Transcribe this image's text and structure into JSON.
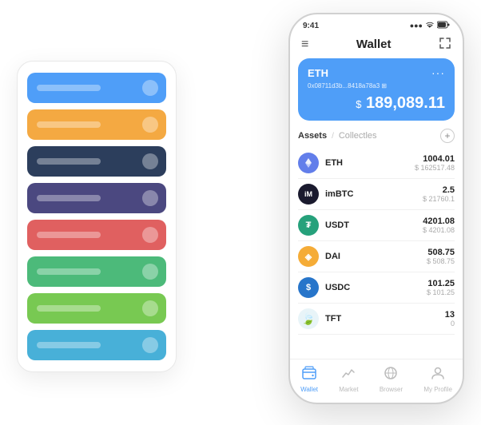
{
  "scene": {
    "leftPanel": {
      "cards": [
        {
          "color": "card-blue",
          "id": "card-1"
        },
        {
          "color": "card-orange",
          "id": "card-2"
        },
        {
          "color": "card-dark",
          "id": "card-3"
        },
        {
          "color": "card-purple",
          "id": "card-4"
        },
        {
          "color": "card-red",
          "id": "card-5"
        },
        {
          "color": "card-green",
          "id": "card-6"
        },
        {
          "color": "card-light-green",
          "id": "card-7"
        },
        {
          "color": "card-teal",
          "id": "card-8"
        }
      ]
    },
    "phone": {
      "statusBar": {
        "time": "9:41",
        "signal": "●●●",
        "wifi": "▲",
        "battery": "▮▮▮"
      },
      "header": {
        "menuIcon": "≡",
        "title": "Wallet",
        "expandIcon": "⤢"
      },
      "ethCard": {
        "symbol": "ETH",
        "dots": "···",
        "address": "0x08711d3b...8418a78a3 ⊞",
        "dollarSign": "$",
        "balance": "189,089.11"
      },
      "assetsSection": {
        "tabActive": "Assets",
        "separator": "/",
        "tabInactive": "Collectles",
        "addIcon": "+"
      },
      "assets": [
        {
          "name": "ETH",
          "icon": "♦",
          "iconClass": "icon-eth",
          "balance": "1004.01",
          "usd": "$ 162517.48"
        },
        {
          "name": "imBTC",
          "icon": "₿",
          "iconClass": "icon-imbtc",
          "balance": "2.5",
          "usd": "$ 21760.1"
        },
        {
          "name": "USDT",
          "icon": "₮",
          "iconClass": "icon-usdt",
          "balance": "4201.08",
          "usd": "$ 4201.08"
        },
        {
          "name": "DAI",
          "icon": "◈",
          "iconClass": "icon-dai",
          "balance": "508.75",
          "usd": "$ 508.75"
        },
        {
          "name": "USDC",
          "icon": "$",
          "iconClass": "icon-usdc",
          "balance": "101.25",
          "usd": "$ 101.25"
        },
        {
          "name": "TFT",
          "icon": "🍃",
          "iconClass": "icon-tft",
          "balance": "13",
          "usd": "0"
        }
      ],
      "bottomNav": [
        {
          "icon": "◉",
          "label": "Wallet",
          "active": true
        },
        {
          "icon": "📈",
          "label": "Market",
          "active": false
        },
        {
          "icon": "🌐",
          "label": "Browser",
          "active": false
        },
        {
          "icon": "👤",
          "label": "My Profile",
          "active": false
        }
      ]
    }
  }
}
